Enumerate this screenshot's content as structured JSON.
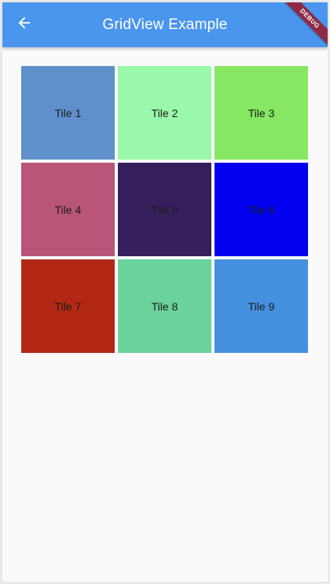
{
  "app_bar": {
    "title": "GridView Example",
    "back_icon": "arrow-back-icon",
    "background": "#4a95ee"
  },
  "debug_banner": {
    "label": "DEBUG",
    "color": "#8e2b45"
  },
  "grid": {
    "columns": 3,
    "tiles": [
      {
        "label": "Tile 1",
        "color": "#6090cb"
      },
      {
        "label": "Tile 2",
        "color": "#9af8aa"
      },
      {
        "label": "Tile 3",
        "color": "#86e763"
      },
      {
        "label": "Tile 4",
        "color": "#b95578"
      },
      {
        "label": "Tile 5",
        "color": "#35205d"
      },
      {
        "label": "Tile 6",
        "color": "#0202f0"
      },
      {
        "label": "Tile 7",
        "color": "#b22815"
      },
      {
        "label": "Tile 8",
        "color": "#6ad39c"
      },
      {
        "label": "Tile 9",
        "color": "#4690e0"
      }
    ]
  }
}
